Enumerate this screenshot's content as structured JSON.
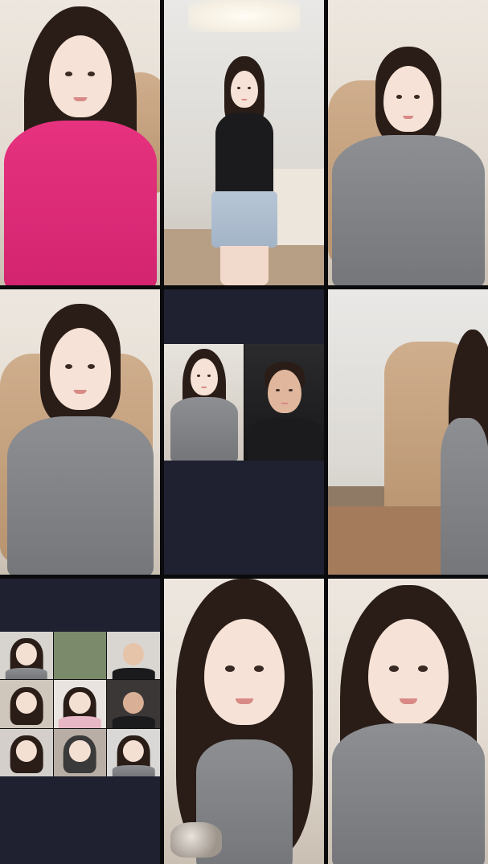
{
  "layout": {
    "columns": 3,
    "rows": 3
  },
  "colors": {
    "background": "#0b0b0d",
    "empty_tile": "#1f2030",
    "cardigan_grey": "#8d8f93",
    "sweater_pink": "#e6327f"
  },
  "tiles": [
    {
      "id": "tile-1",
      "content": "camera-feed"
    },
    {
      "id": "tile-2",
      "content": "camera-feed"
    },
    {
      "id": "tile-3",
      "content": "camera-feed"
    },
    {
      "id": "tile-4",
      "content": "camera-feed"
    },
    {
      "id": "tile-5",
      "content": "split-screen-feed"
    },
    {
      "id": "tile-6",
      "content": "camera-feed"
    },
    {
      "id": "tile-7",
      "content": "mosaic-feed",
      "mosaic_cells": 9
    },
    {
      "id": "tile-8",
      "content": "camera-feed"
    },
    {
      "id": "tile-9",
      "content": "camera-feed"
    }
  ]
}
